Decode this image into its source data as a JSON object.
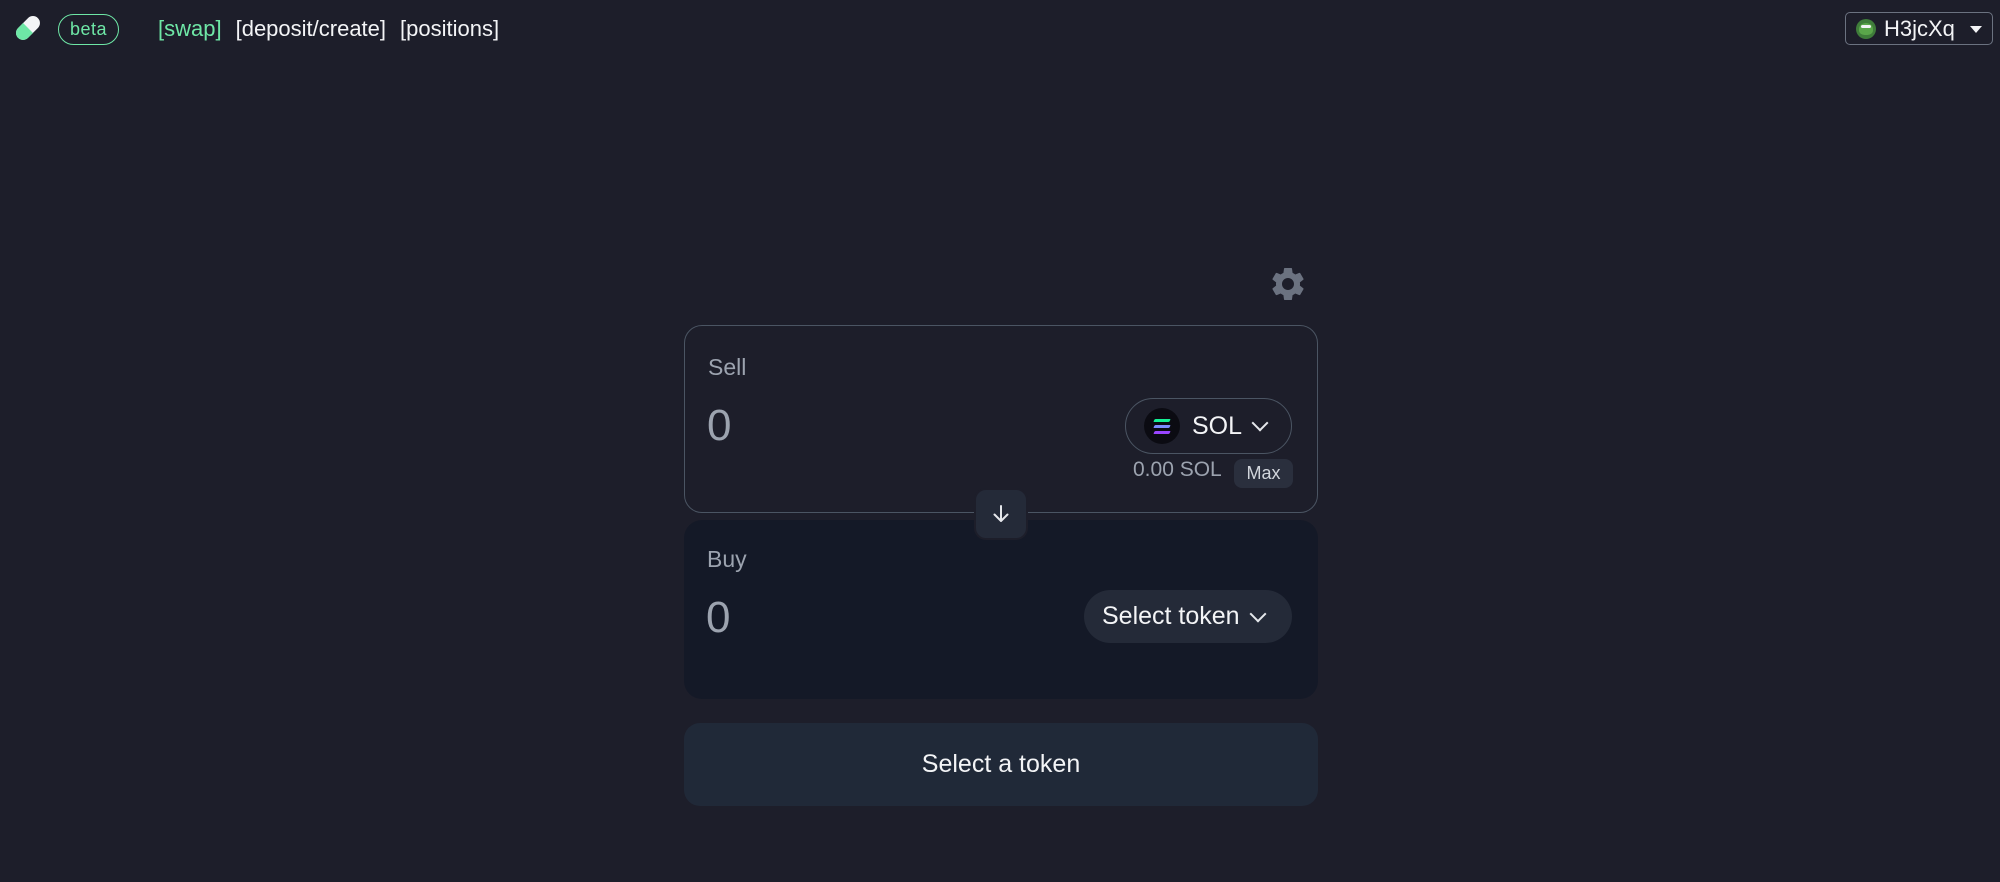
{
  "header": {
    "logo_icon": "pill-icon",
    "beta_label": "beta",
    "nav": [
      {
        "label": "[swap]",
        "active": true
      },
      {
        "label": "[deposit/create]",
        "active": false
      },
      {
        "label": "[positions]",
        "active": false
      }
    ],
    "wallet": {
      "address": "H3jcXq",
      "avatar_icon": "frog-avatar-icon"
    }
  },
  "swap": {
    "settings_icon": "gear-icon",
    "sell": {
      "label": "Sell",
      "amount": "0",
      "token": "SOL",
      "balance": "0.00 SOL",
      "max_label": "Max"
    },
    "direction_icon": "arrow-down-icon",
    "buy": {
      "label": "Buy",
      "amount": "0",
      "token_button": "Select token"
    },
    "cta_label": "Select a token"
  },
  "colors": {
    "background": "#1d1e2a",
    "accent": "#6ee7a6",
    "buy_panel": "#141927",
    "button": "#202938"
  }
}
